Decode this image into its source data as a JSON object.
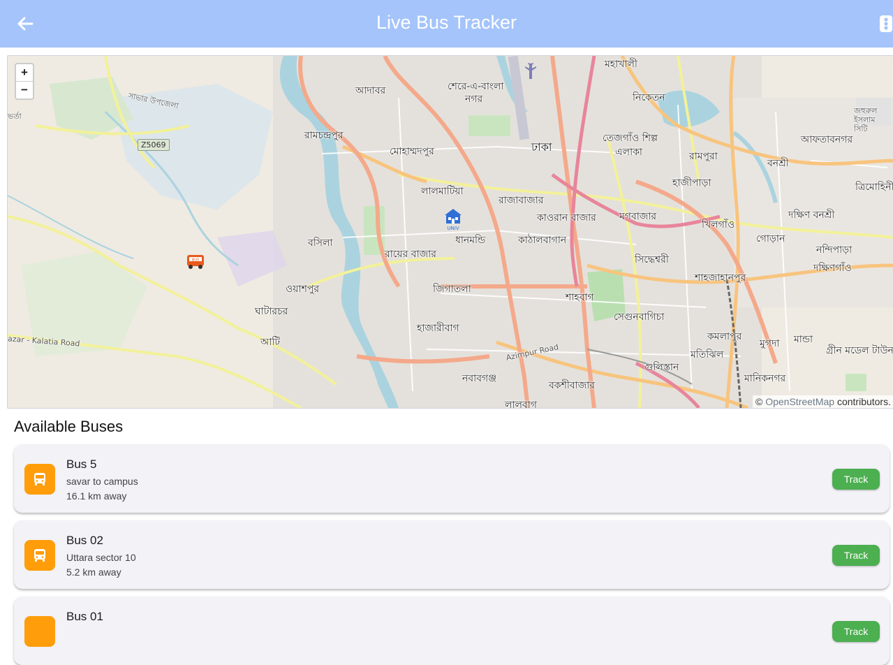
{
  "app_bar": {
    "title": "Live Bus Tracker",
    "back_icon": "arrow-left-icon",
    "action_icon": "traffic-light-icon",
    "background": "#a4c4fb"
  },
  "map": {
    "zoom_in": "+",
    "zoom_out": "−",
    "attribution_prefix": "©",
    "attribution_link": "OpenStreetMap",
    "attribution_suffix": "contributors.",
    "labels": [
      "মহাখালী",
      "আদাবর",
      "শেরে-এ-বাংলা",
      "নগর",
      "নিকেতন",
      "রামচন্দ্রপুর",
      "মোহাম্মদপুর",
      "ঢাকা",
      "তেজগাঁও শিল্প",
      "এলাকা",
      "রামপুরা",
      "বনশ্রী",
      "আফতাবনগর",
      "হাজীপাড়া",
      "লালমাটিয়া",
      "রাজাবাজার",
      "ত্রিমোহিনী",
      "কাওরান বাজার",
      "মগবাজার",
      "দক্ষিণ বনশ্রী",
      "খিলগাঁও",
      "ধানমন্ডি",
      "বসিলা",
      "রায়ের বাজার",
      "কাঠালবাগান",
      "গোড়ান",
      "নন্দিপাড়া",
      "সিদ্ধেশ্বরী",
      "দক্ষিণগাঁও",
      "শাহজাহানপুর",
      "ওয়াশপুর",
      "জিগাতলা",
      "শাহবাগ",
      "ঘাটারচর",
      "সেগুনবাগিচা",
      "হাজারীবাগ",
      "কমলাপুর",
      "মুগদা",
      "মান্ডা",
      "আটি",
      "মতিঝিল",
      "গ্রীন মডেল টাউন",
      "গুলিস্তান",
      "নবাবগঞ্জ",
      "বকশীবাজার",
      "মানিকনগর",
      "লালবাগ",
      "সাভার উপজেলা",
      "জহুরুল ইসলাম সিটি",
      "Azimpur Road",
      "azar - Kalatia Road",
      "Z5069",
      "ভর্তা"
    ]
  },
  "buses_section": {
    "title": "Available Buses",
    "buses": [
      {
        "name": "Bus 5",
        "route": "savar to campus",
        "distance": "16.1 km away",
        "action": "Track"
      },
      {
        "name": "Bus 02",
        "route": "Uttara sector 10",
        "distance": "5.2 km away",
        "action": "Track"
      },
      {
        "name": "Bus 01",
        "route": "",
        "distance": "",
        "action": "Track"
      }
    ]
  },
  "colors": {
    "bus_icon_bg": "#ff9d0a",
    "track_button": "#4caf50",
    "card_bg": "#f2f2f7"
  }
}
